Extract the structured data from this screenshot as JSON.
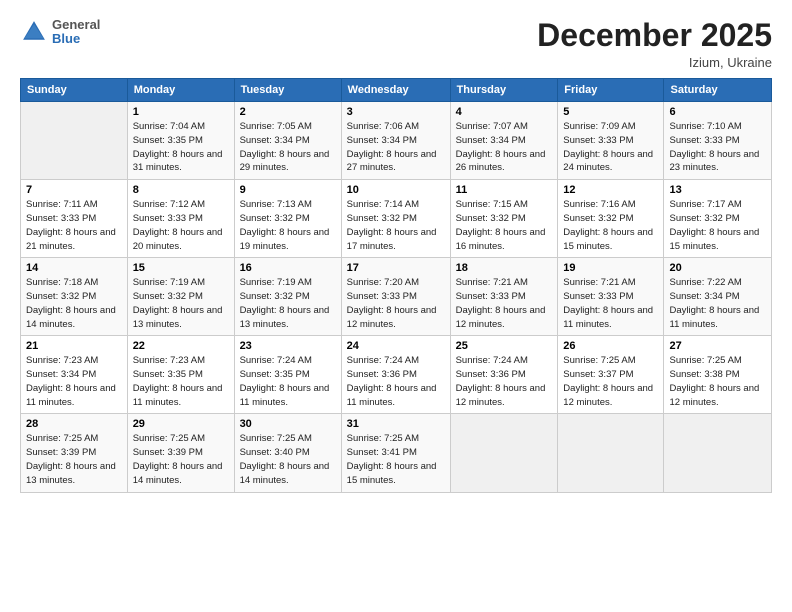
{
  "logo": {
    "general": "General",
    "blue": "Blue"
  },
  "header": {
    "month": "December 2025",
    "location": "Izium, Ukraine"
  },
  "weekdays": [
    "Sunday",
    "Monday",
    "Tuesday",
    "Wednesday",
    "Thursday",
    "Friday",
    "Saturday"
  ],
  "weeks": [
    [
      {
        "day": "",
        "empty": true
      },
      {
        "day": "1",
        "sunrise": "7:04 AM",
        "sunset": "3:35 PM",
        "daylight": "8 hours and 31 minutes."
      },
      {
        "day": "2",
        "sunrise": "7:05 AM",
        "sunset": "3:34 PM",
        "daylight": "8 hours and 29 minutes."
      },
      {
        "day": "3",
        "sunrise": "7:06 AM",
        "sunset": "3:34 PM",
        "daylight": "8 hours and 27 minutes."
      },
      {
        "day": "4",
        "sunrise": "7:07 AM",
        "sunset": "3:34 PM",
        "daylight": "8 hours and 26 minutes."
      },
      {
        "day": "5",
        "sunrise": "7:09 AM",
        "sunset": "3:33 PM",
        "daylight": "8 hours and 24 minutes."
      },
      {
        "day": "6",
        "sunrise": "7:10 AM",
        "sunset": "3:33 PM",
        "daylight": "8 hours and 23 minutes."
      }
    ],
    [
      {
        "day": "7",
        "sunrise": "7:11 AM",
        "sunset": "3:33 PM",
        "daylight": "8 hours and 21 minutes."
      },
      {
        "day": "8",
        "sunrise": "7:12 AM",
        "sunset": "3:33 PM",
        "daylight": "8 hours and 20 minutes."
      },
      {
        "day": "9",
        "sunrise": "7:13 AM",
        "sunset": "3:32 PM",
        "daylight": "8 hours and 19 minutes."
      },
      {
        "day": "10",
        "sunrise": "7:14 AM",
        "sunset": "3:32 PM",
        "daylight": "8 hours and 17 minutes."
      },
      {
        "day": "11",
        "sunrise": "7:15 AM",
        "sunset": "3:32 PM",
        "daylight": "8 hours and 16 minutes."
      },
      {
        "day": "12",
        "sunrise": "7:16 AM",
        "sunset": "3:32 PM",
        "daylight": "8 hours and 15 minutes."
      },
      {
        "day": "13",
        "sunrise": "7:17 AM",
        "sunset": "3:32 PM",
        "daylight": "8 hours and 15 minutes."
      }
    ],
    [
      {
        "day": "14",
        "sunrise": "7:18 AM",
        "sunset": "3:32 PM",
        "daylight": "8 hours and 14 minutes."
      },
      {
        "day": "15",
        "sunrise": "7:19 AM",
        "sunset": "3:32 PM",
        "daylight": "8 hours and 13 minutes."
      },
      {
        "day": "16",
        "sunrise": "7:19 AM",
        "sunset": "3:32 PM",
        "daylight": "8 hours and 13 minutes."
      },
      {
        "day": "17",
        "sunrise": "7:20 AM",
        "sunset": "3:33 PM",
        "daylight": "8 hours and 12 minutes."
      },
      {
        "day": "18",
        "sunrise": "7:21 AM",
        "sunset": "3:33 PM",
        "daylight": "8 hours and 12 minutes."
      },
      {
        "day": "19",
        "sunrise": "7:21 AM",
        "sunset": "3:33 PM",
        "daylight": "8 hours and 11 minutes."
      },
      {
        "day": "20",
        "sunrise": "7:22 AM",
        "sunset": "3:34 PM",
        "daylight": "8 hours and 11 minutes."
      }
    ],
    [
      {
        "day": "21",
        "sunrise": "7:23 AM",
        "sunset": "3:34 PM",
        "daylight": "8 hours and 11 minutes."
      },
      {
        "day": "22",
        "sunrise": "7:23 AM",
        "sunset": "3:35 PM",
        "daylight": "8 hours and 11 minutes."
      },
      {
        "day": "23",
        "sunrise": "7:24 AM",
        "sunset": "3:35 PM",
        "daylight": "8 hours and 11 minutes."
      },
      {
        "day": "24",
        "sunrise": "7:24 AM",
        "sunset": "3:36 PM",
        "daylight": "8 hours and 11 minutes."
      },
      {
        "day": "25",
        "sunrise": "7:24 AM",
        "sunset": "3:36 PM",
        "daylight": "8 hours and 12 minutes."
      },
      {
        "day": "26",
        "sunrise": "7:25 AM",
        "sunset": "3:37 PM",
        "daylight": "8 hours and 12 minutes."
      },
      {
        "day": "27",
        "sunrise": "7:25 AM",
        "sunset": "3:38 PM",
        "daylight": "8 hours and 12 minutes."
      }
    ],
    [
      {
        "day": "28",
        "sunrise": "7:25 AM",
        "sunset": "3:39 PM",
        "daylight": "8 hours and 13 minutes."
      },
      {
        "day": "29",
        "sunrise": "7:25 AM",
        "sunset": "3:39 PM",
        "daylight": "8 hours and 14 minutes."
      },
      {
        "day": "30",
        "sunrise": "7:25 AM",
        "sunset": "3:40 PM",
        "daylight": "8 hours and 14 minutes."
      },
      {
        "day": "31",
        "sunrise": "7:25 AM",
        "sunset": "3:41 PM",
        "daylight": "8 hours and 15 minutes."
      },
      {
        "day": "",
        "empty": true
      },
      {
        "day": "",
        "empty": true
      },
      {
        "day": "",
        "empty": true
      }
    ]
  ]
}
